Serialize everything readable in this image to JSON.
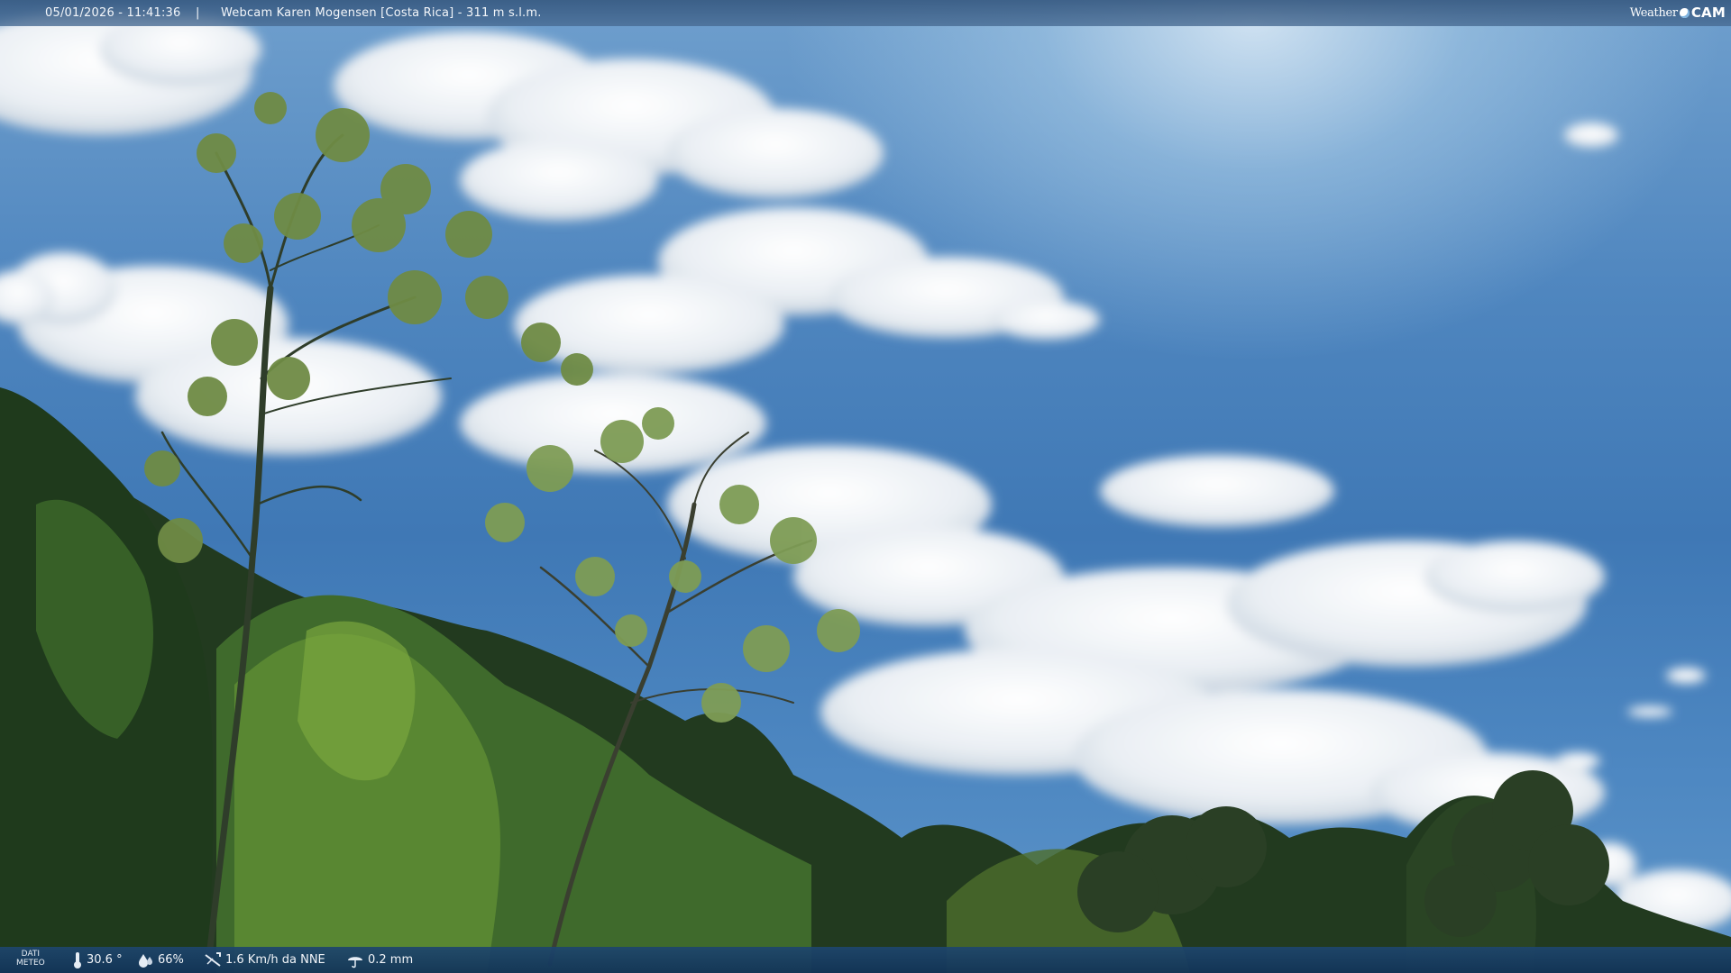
{
  "overlay": {
    "datetime": "05/01/2026 - 11:41:36",
    "separator": "|",
    "title": "Webcam Karen Mogensen [Costa Rica] - 311 m s.l.m.",
    "logo_weather": "Weather",
    "logo_cam": "CAM"
  },
  "meteo": {
    "tag_line1": "DATI",
    "tag_line2": "METEO",
    "temperature": "30.6 °",
    "humidity": "66%",
    "wind": "1.6 Km/h da NNE",
    "rain": "0.2 mm"
  },
  "icons": {
    "temperature": "thermometer-icon",
    "humidity": "humidity-drop-icon",
    "wind": "wind-icon",
    "rain": "rain-icon"
  }
}
